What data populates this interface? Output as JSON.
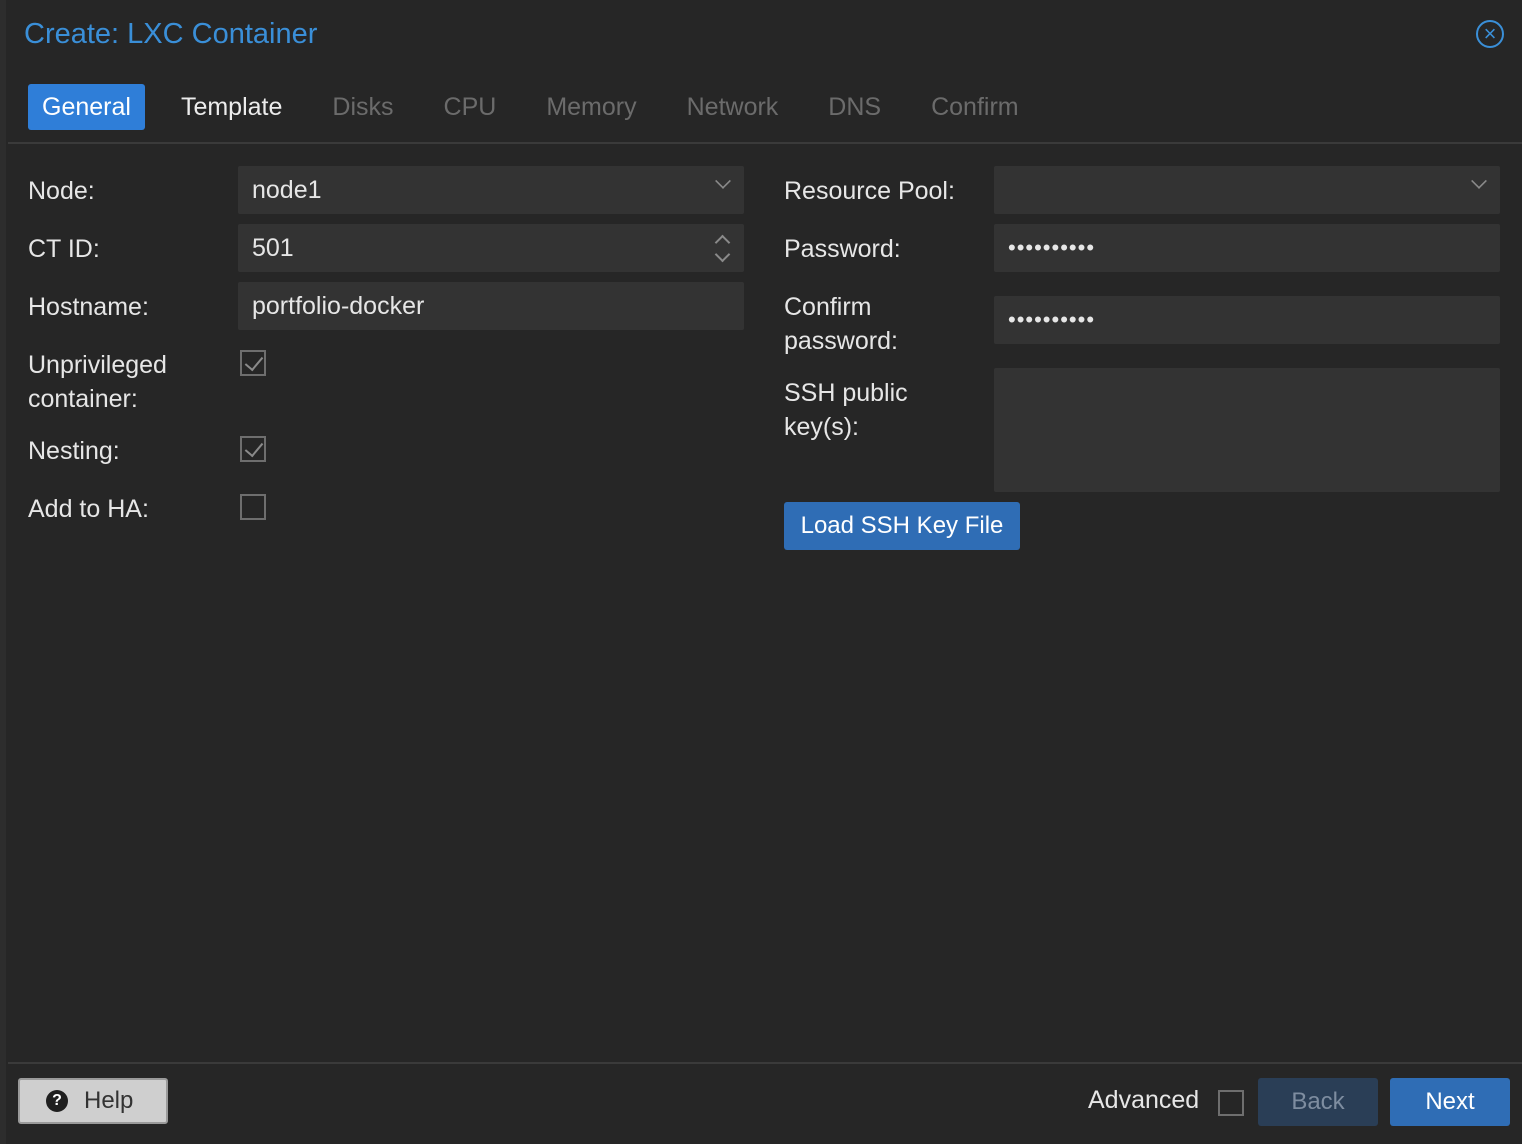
{
  "dialog": {
    "title": "Create: LXC Container"
  },
  "tabs": [
    {
      "label": "General",
      "state": "active"
    },
    {
      "label": "Template",
      "state": "enabled"
    },
    {
      "label": "Disks",
      "state": "disabled"
    },
    {
      "label": "CPU",
      "state": "disabled"
    },
    {
      "label": "Memory",
      "state": "disabled"
    },
    {
      "label": "Network",
      "state": "disabled"
    },
    {
      "label": "DNS",
      "state": "disabled"
    },
    {
      "label": "Confirm",
      "state": "disabled"
    }
  ],
  "form_left": {
    "node_label": "Node:",
    "node_value": "node1",
    "ctid_label": "CT ID:",
    "ctid_value": "501",
    "hostname_label": "Hostname:",
    "hostname_value": "portfolio-docker",
    "unprivileged_label_1": "Unprivileged",
    "unprivileged_label_2": "container:",
    "unprivileged_checked": true,
    "nesting_label": "Nesting:",
    "nesting_checked": true,
    "ha_label": "Add to HA:",
    "ha_checked": false
  },
  "form_right": {
    "pool_label": "Resource Pool:",
    "pool_value": "",
    "password_label": "Password:",
    "password_value": "••••••••••",
    "confirm_label_1": "Confirm",
    "confirm_label_2": "password:",
    "confirm_value": "••••••••••",
    "ssh_label_1": "SSH public",
    "ssh_label_2": "key(s):",
    "ssh_value": "",
    "load_ssh_button": "Load SSH Key File"
  },
  "footer": {
    "help_label": "Help",
    "help_icon": "?",
    "advanced_label": "Advanced",
    "advanced_checked": false,
    "back_label": "Back",
    "next_label": "Next"
  },
  "colors": {
    "accent": "#2f7ed8",
    "title": "#3a8fd8",
    "background": "#262626",
    "field": "#333333"
  }
}
